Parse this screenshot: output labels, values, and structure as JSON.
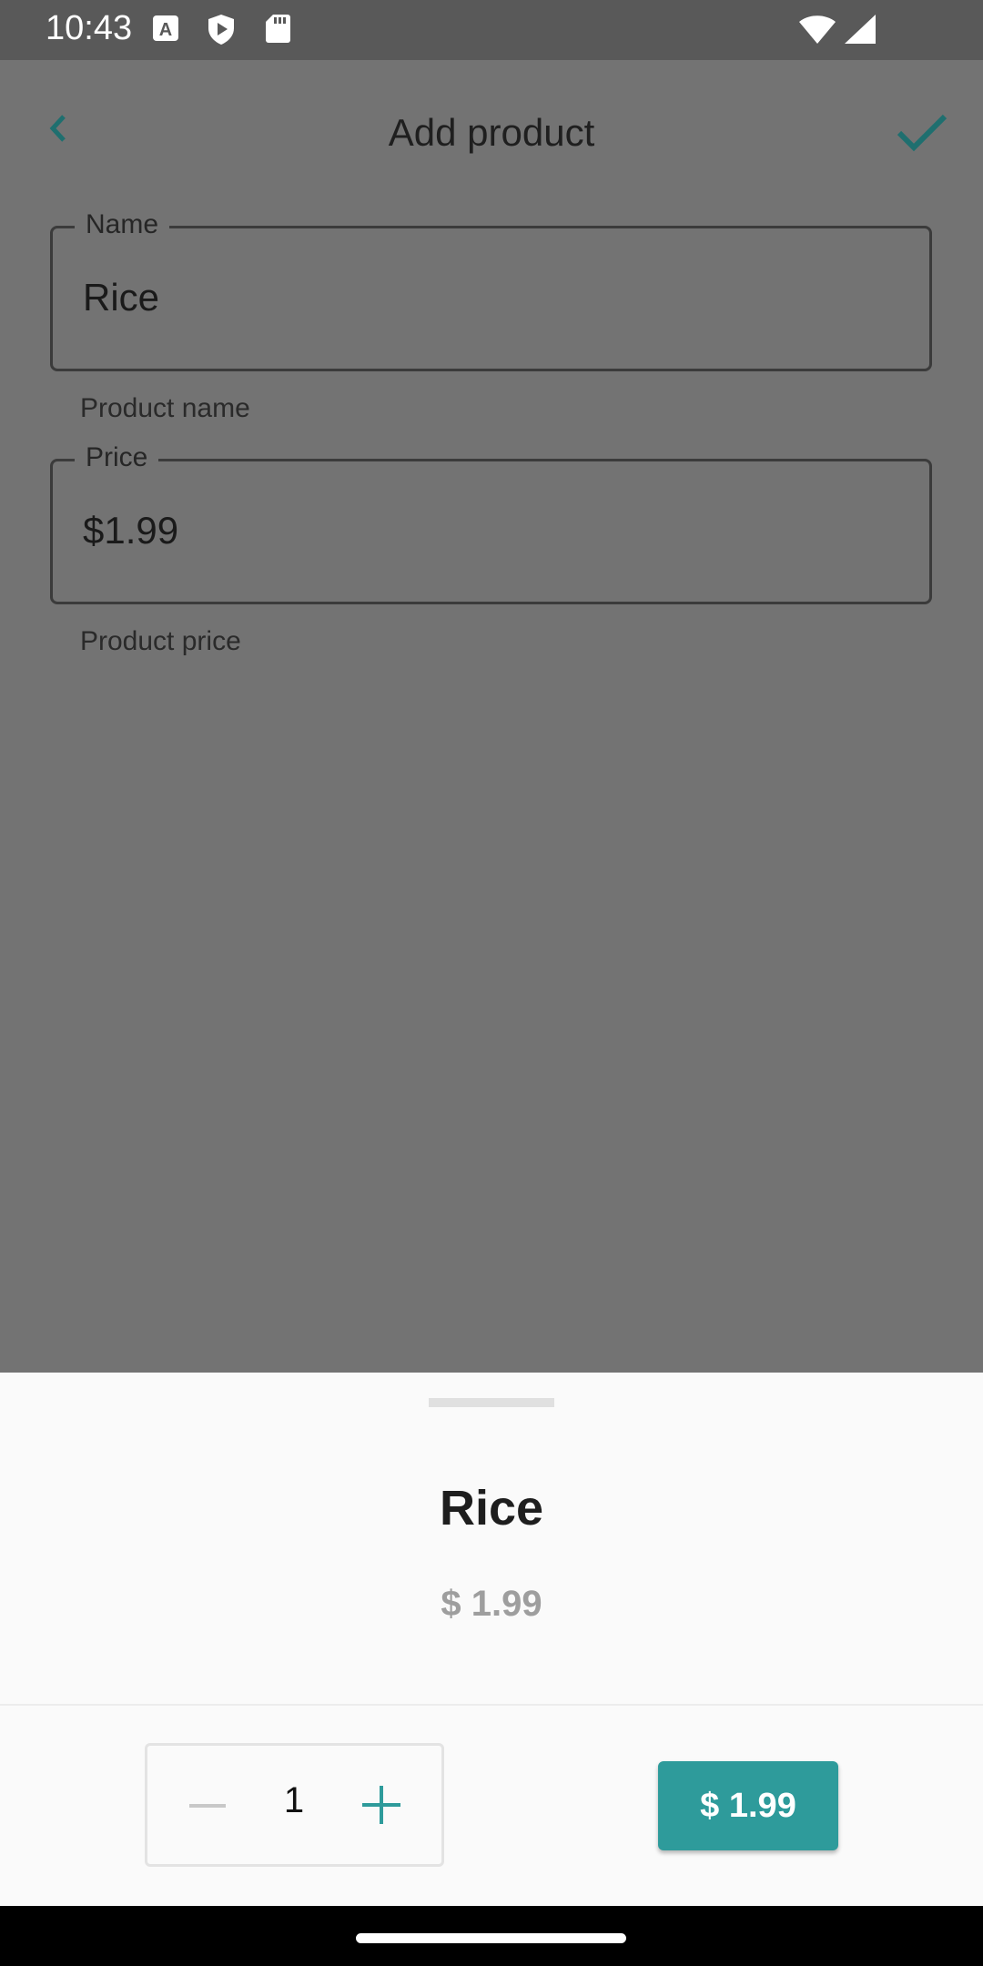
{
  "status_bar": {
    "time": "10:43",
    "icons": [
      "a-notification-icon",
      "shield-play-icon",
      "sd-card-icon",
      "wifi-icon",
      "signal-icon"
    ]
  },
  "app_bar": {
    "title": "Add product",
    "back_icon": "chevron-left-icon",
    "confirm_icon": "check-icon",
    "accent_color": "#1f6f6f"
  },
  "form": {
    "name_field": {
      "label": "Name",
      "value": "Rice",
      "helper": "Product name"
    },
    "price_field": {
      "label": "Price",
      "value": "$1.99",
      "helper": "Product price"
    }
  },
  "sheet": {
    "product_name": "Rice",
    "product_price": "$ 1.99",
    "quantity": "1",
    "buy_label": "$ 1.99",
    "accent_color": "#2e9b9b"
  }
}
